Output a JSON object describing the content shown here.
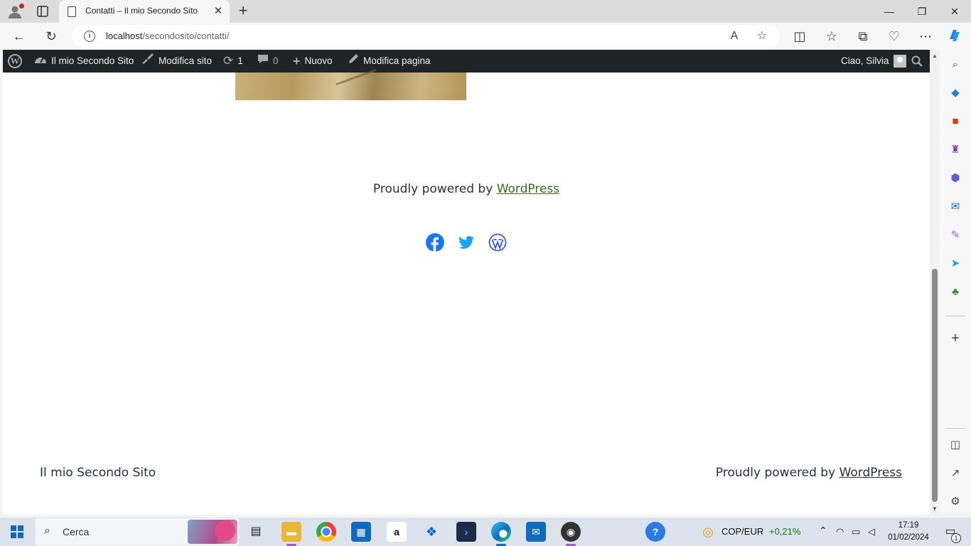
{
  "browser": {
    "tab_title": "Contatti – Il mio Secondo Sito",
    "url_host": "localhost",
    "url_path": "/secondosito/contatti/"
  },
  "admin_bar": {
    "site_name": "Il mio Secondo Sito",
    "customize": "Modifica sito",
    "updates_count": "1",
    "comments_count": "0",
    "new": "Nuovo",
    "edit_page": "Modifica pagina",
    "greeting": "Ciao, Silvia"
  },
  "page": {
    "powered_prefix": "Proudly powered by ",
    "powered_link": "WordPress",
    "social_icons": [
      "facebook-icon",
      "twitter-icon",
      "wordpress-icon"
    ]
  },
  "footer": {
    "site_title": "Il mio Secondo Sito",
    "powered_prefix": "Proudly powered by ",
    "powered_link": "WordPress"
  },
  "taskbar": {
    "search_placeholder": "Cerca",
    "stock_label": "COP/EUR",
    "stock_change": "+0,21%",
    "time": "17:19",
    "date": "01/02/2024",
    "notification_count": "1"
  },
  "colors": {
    "admin_bar_bg": "#1d2327",
    "link_green": "#3a6b1f",
    "facebook_blue": "#1877f2",
    "twitter_blue": "#1da1f2",
    "wordpress_blue": "#3858e9",
    "stock_green": "#107c10"
  }
}
